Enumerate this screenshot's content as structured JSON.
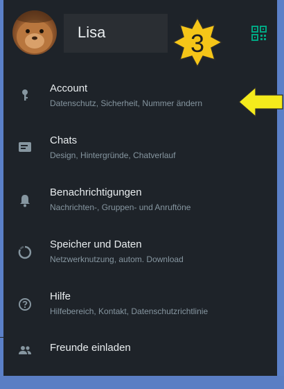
{
  "profile": {
    "name": "Lisa"
  },
  "badge": {
    "number": "3",
    "color": "#f5c518"
  },
  "colors": {
    "panel_bg": "#1e2329",
    "frame_bg": "#5b80c8",
    "title_text": "#e9edef",
    "subtitle_text": "#8696a0",
    "accent_green": "#00a884",
    "arrow_yellow": "#f4ea1c"
  },
  "menu": {
    "items": [
      {
        "icon": "key-icon",
        "title": "Account",
        "subtitle": "Datenschutz, Sicherheit, Nummer ändern"
      },
      {
        "icon": "chat-icon",
        "title": "Chats",
        "subtitle": "Design, Hintergründe, Chatverlauf"
      },
      {
        "icon": "bell-icon",
        "title": "Benachrichtigungen",
        "subtitle": "Nachrichten-, Gruppen- und Anruftöne"
      },
      {
        "icon": "storage-icon",
        "title": "Speicher und Daten",
        "subtitle": "Netzwerknutzung, autom. Download"
      },
      {
        "icon": "help-icon",
        "title": "Hilfe",
        "subtitle": "Hilfebereich, Kontakt, Datenschutzrichtlinie"
      },
      {
        "icon": "people-icon",
        "title": "Freunde einladen",
        "subtitle": ""
      }
    ]
  }
}
